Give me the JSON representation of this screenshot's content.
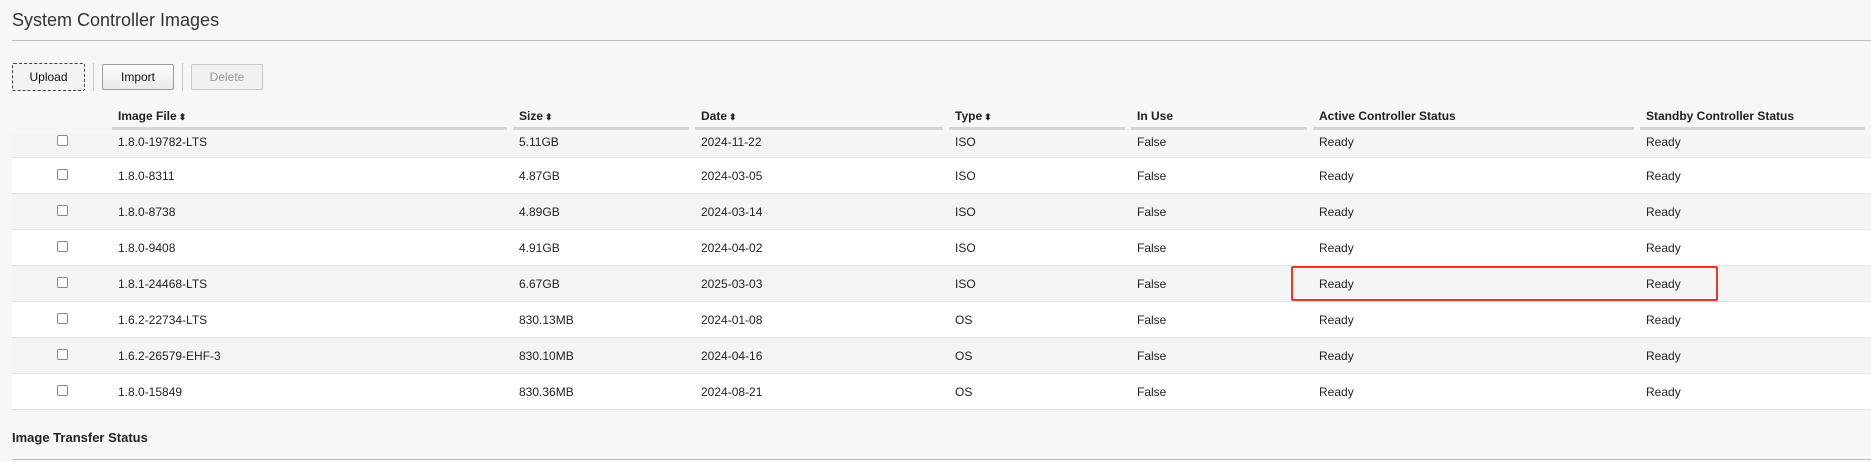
{
  "page": {
    "title": "System Controller Images"
  },
  "toolbar": {
    "upload_label": "Upload",
    "import_label": "Import",
    "delete_label": "Delete"
  },
  "table": {
    "columns": [
      {
        "label": "Image File",
        "sortable": true
      },
      {
        "label": "Size",
        "sortable": true
      },
      {
        "label": "Date",
        "sortable": true
      },
      {
        "label": "Type",
        "sortable": true
      },
      {
        "label": "In Use",
        "sortable": false
      },
      {
        "label": "Active Controller Status",
        "sortable": false
      },
      {
        "label": "Standby Controller Status",
        "sortable": false
      }
    ],
    "sort_icon": "⬍",
    "rows": [
      {
        "image": "1.8.0-19782-LTS",
        "size": "5.11GB",
        "date": "2024-11-22",
        "type": "ISO",
        "in_use": "False",
        "active": "Ready",
        "standby": "Ready"
      },
      {
        "image": "1.8.0-8311",
        "size": "4.87GB",
        "date": "2024-03-05",
        "type": "ISO",
        "in_use": "False",
        "active": "Ready",
        "standby": "Ready"
      },
      {
        "image": "1.8.0-8738",
        "size": "4.89GB",
        "date": "2024-03-14",
        "type": "ISO",
        "in_use": "False",
        "active": "Ready",
        "standby": "Ready"
      },
      {
        "image": "1.8.0-9408",
        "size": "4.91GB",
        "date": "2024-04-02",
        "type": "ISO",
        "in_use": "False",
        "active": "Ready",
        "standby": "Ready"
      },
      {
        "image": "1.8.1-24468-LTS",
        "size": "6.67GB",
        "date": "2025-03-03",
        "type": "ISO",
        "in_use": "False",
        "active": "Ready",
        "standby": "Ready"
      },
      {
        "image": "1.6.2-22734-LTS",
        "size": "830.13MB",
        "date": "2024-01-08",
        "type": "OS",
        "in_use": "False",
        "active": "Ready",
        "standby": "Ready"
      },
      {
        "image": "1.6.2-26579-EHF-3",
        "size": "830.10MB",
        "date": "2024-04-16",
        "type": "OS",
        "in_use": "False",
        "active": "Ready",
        "standby": "Ready"
      },
      {
        "image": "1.8.0-15849",
        "size": "830.36MB",
        "date": "2024-08-21",
        "type": "OS",
        "in_use": "False",
        "active": "Ready",
        "standby": "Ready"
      }
    ]
  },
  "section": {
    "transfer_title": "Image Transfer Status"
  },
  "colors": {
    "highlight": "#e8362b"
  }
}
